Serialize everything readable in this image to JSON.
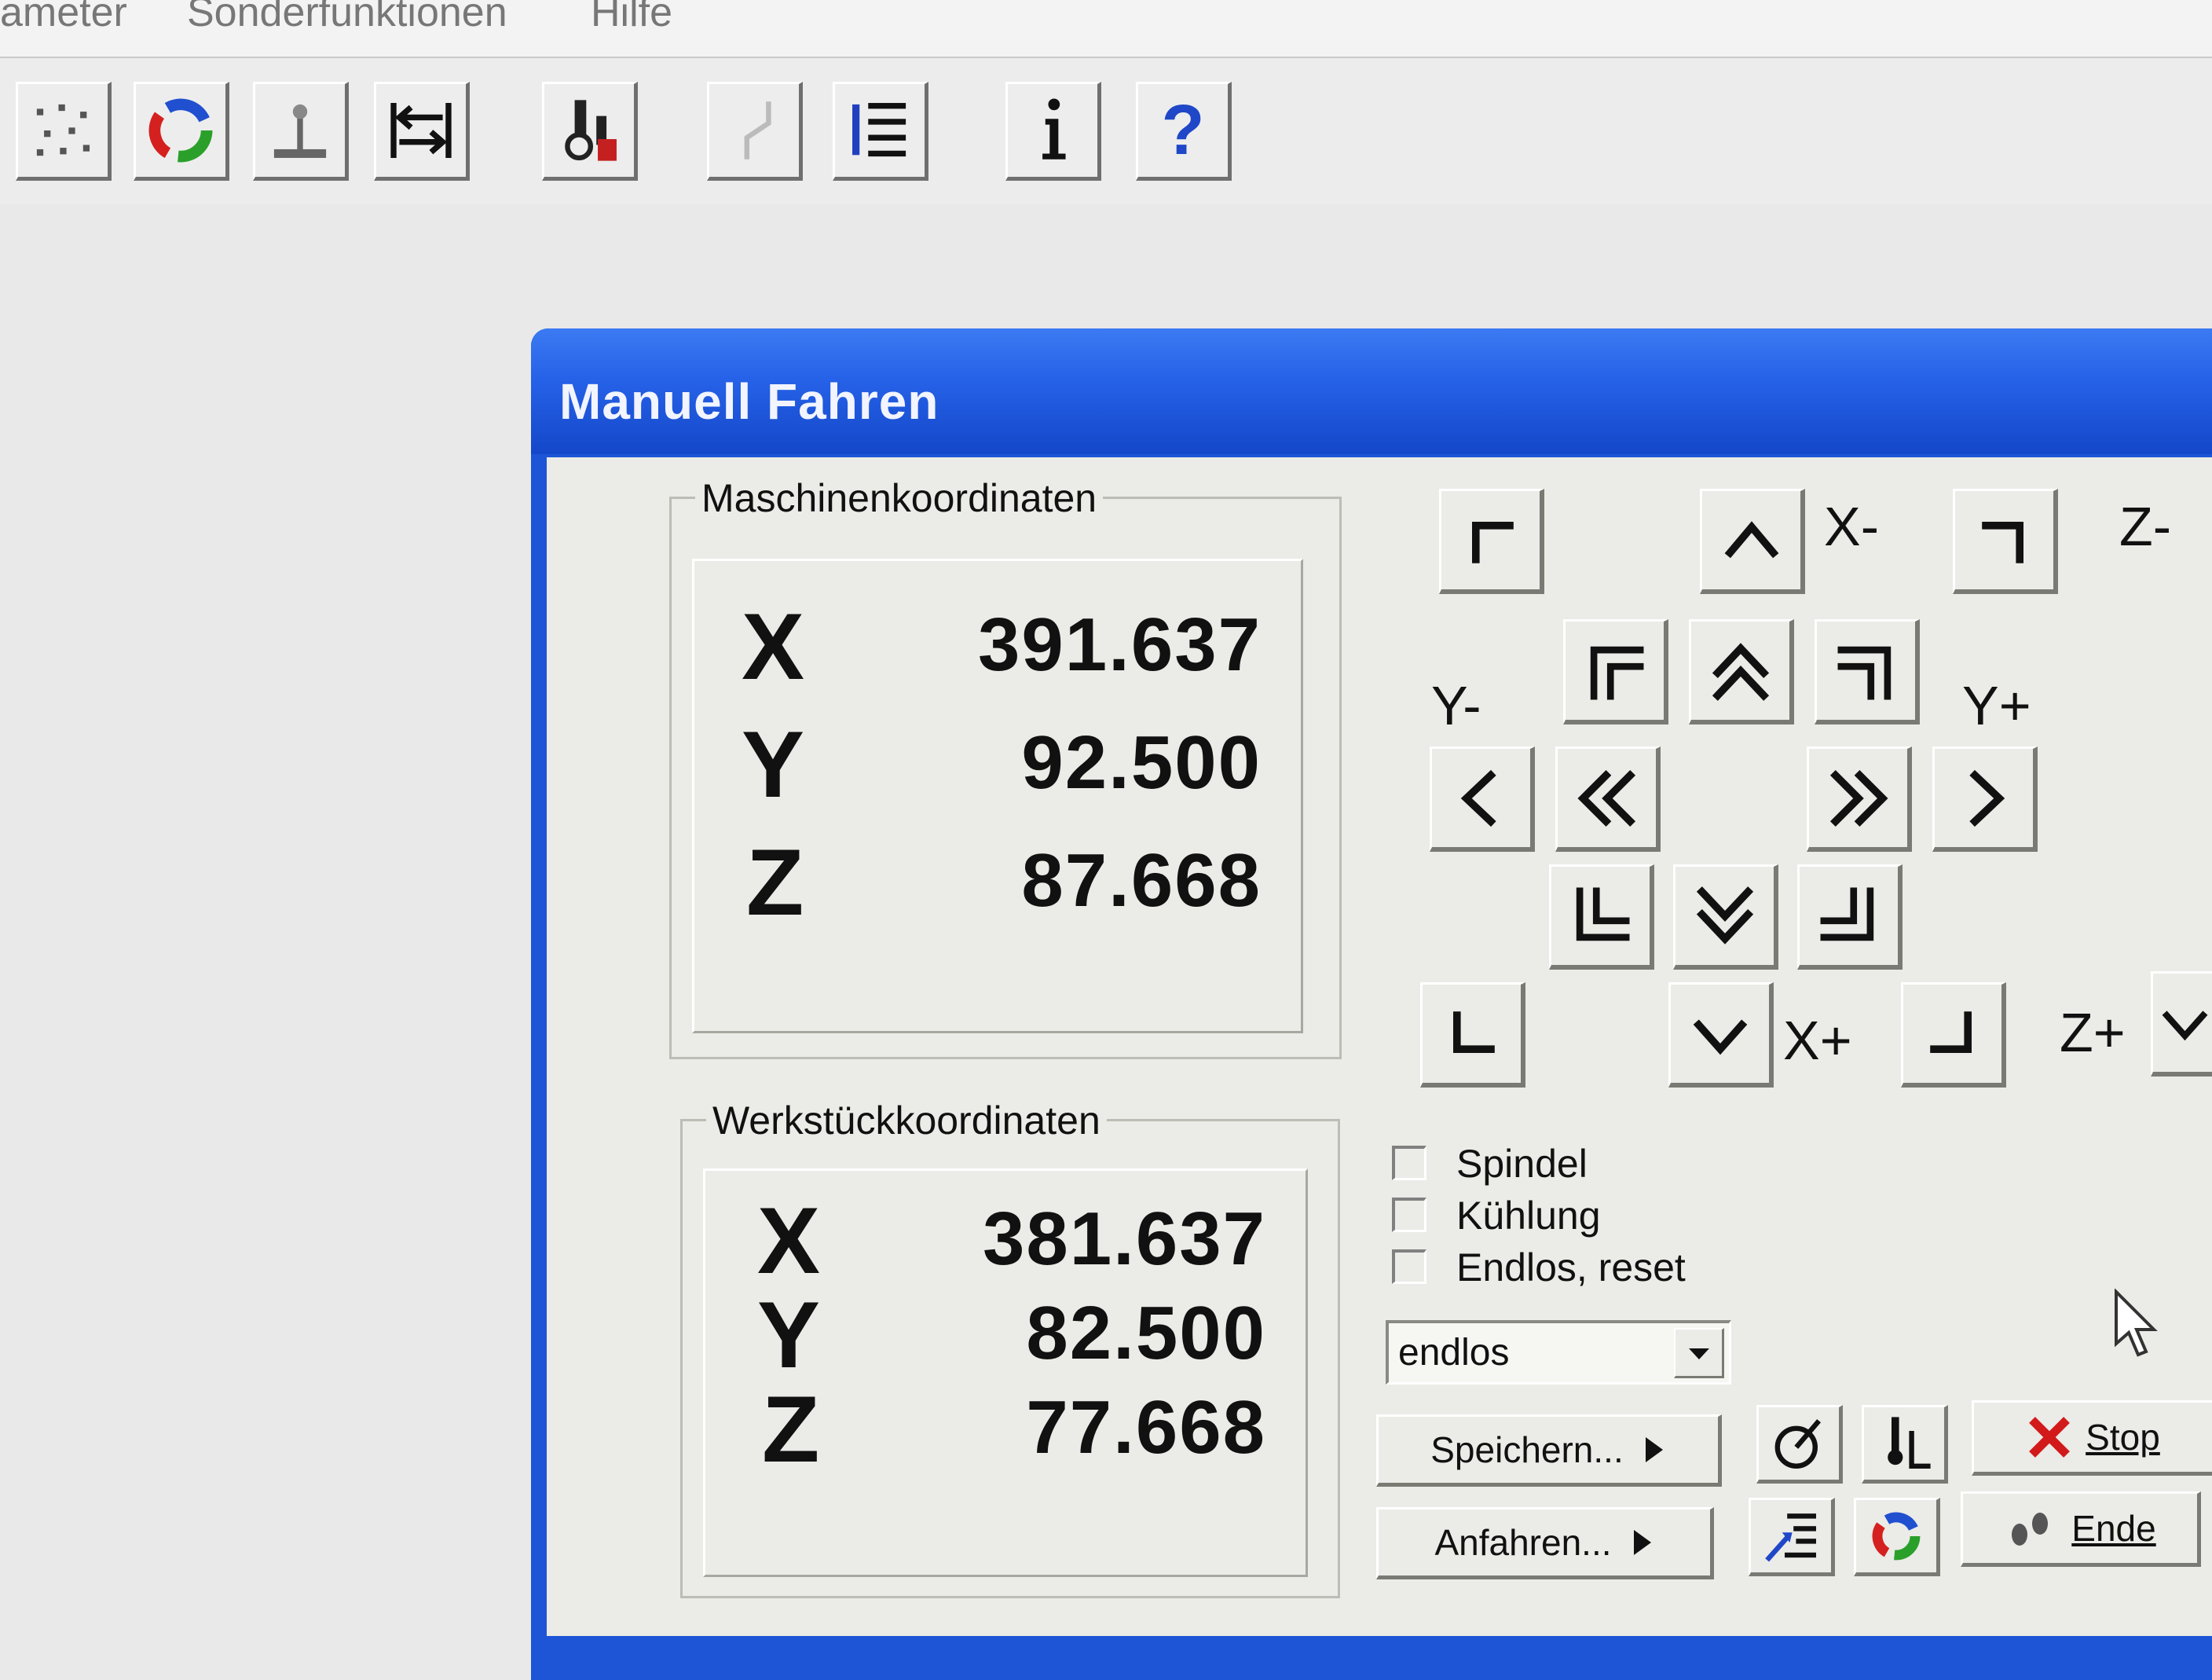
{
  "menu": {
    "items": [
      "ameter",
      "Sonderfunktionen",
      "Hilfe"
    ]
  },
  "toolbar": {
    "icons": [
      "grid-dots-icon",
      "color-wheel-icon",
      "joystick-icon",
      "reference-arrows-icon",
      "tool-change-icon",
      "disabled-path-icon",
      "list-icon",
      "info-icon",
      "help-icon"
    ],
    "help_label": "?"
  },
  "dialog": {
    "title": "Manuell Fahren",
    "machine": {
      "legend": "Maschinenkoordinaten",
      "rows": [
        {
          "axis": "X",
          "value": "391.637"
        },
        {
          "axis": "Y",
          "value": "92.500"
        },
        {
          "axis": "Z",
          "value": "87.668"
        }
      ]
    },
    "workpiece": {
      "legend": "Werkstückkoordinaten",
      "rows": [
        {
          "axis": "X",
          "value": "381.637"
        },
        {
          "axis": "Y",
          "value": "82.500"
        },
        {
          "axis": "Z",
          "value": "77.668"
        }
      ]
    },
    "axis_labels": {
      "x_minus": "X-",
      "x_plus": "X+",
      "y_minus": "Y-",
      "y_plus": "Y+",
      "z_minus": "Z-",
      "z_plus": "Z+"
    },
    "checkboxes": {
      "spindel": "Spindel",
      "kuehlung": "Kühlung",
      "endlos": "Endlos, reset"
    },
    "mode_select": {
      "value": "endlos"
    },
    "buttons": {
      "speichern": "Speichern...",
      "anfahren": "Anfahren...",
      "stop": "Stop",
      "ende": "Ende"
    }
  }
}
